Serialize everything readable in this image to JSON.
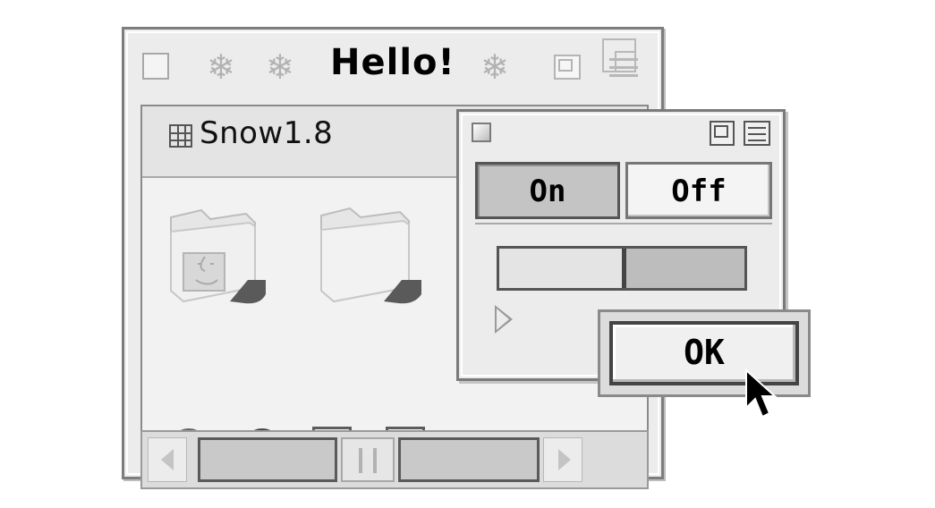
{
  "window": {
    "title": "Hello!",
    "header_label": "Snow1.8",
    "icons": [
      "close-box-icon",
      "snowflake-icon",
      "zoom-box-icon",
      "windowshade-icon",
      "grid-icon",
      "finder-folder-icon",
      "folder-icon"
    ],
    "controls": {
      "radio_1_selected": false,
      "radio_2_selected": true,
      "checkbox_1_checked": true,
      "checkbox_2_checked": false
    },
    "scrollbar_thumb_position": 0.5
  },
  "panel": {
    "segments": [
      "On",
      "Off"
    ],
    "selected_segment": "On",
    "slider_value": 0.5,
    "ok_label": "OK"
  },
  "colors": {
    "window_bg": "#ececec",
    "selected_segment": "#c4c4c4"
  }
}
